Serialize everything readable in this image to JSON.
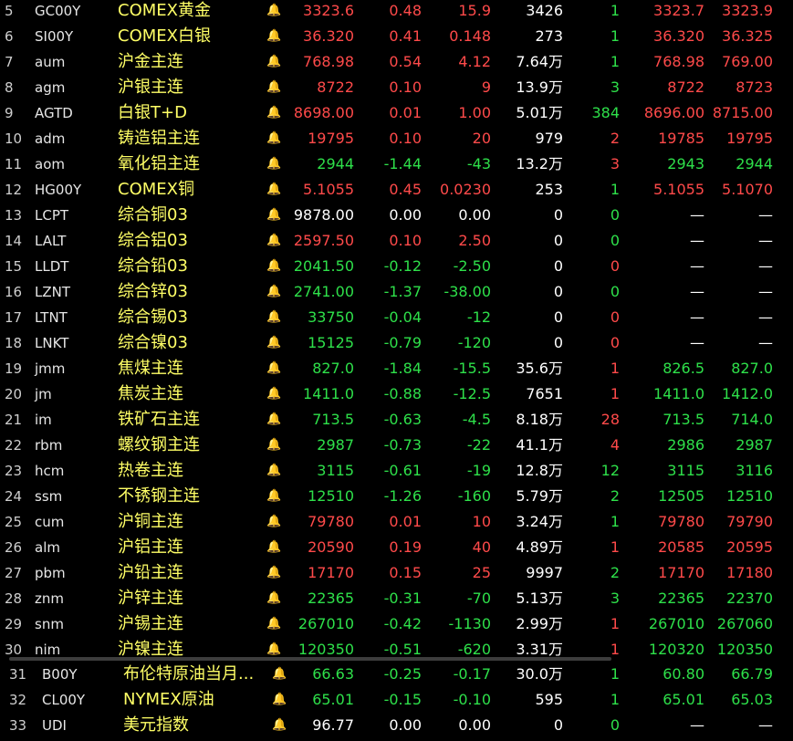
{
  "colors": {
    "up": "#ff4a4a",
    "down": "#2ee04a",
    "flat": "#ffffff",
    "name": "#ffff66",
    "background": "#000000"
  },
  "icons": {
    "row_alert": "bell-icon"
  },
  "bell_glyph": "🔔",
  "rows": [
    {
      "idx": "5",
      "code": "GC00Y",
      "name": "COMEX黄金",
      "price": "3323.6",
      "pct": "0.48",
      "chg": "15.9",
      "vol": "3426",
      "cur": "1",
      "bid": "3323.7",
      "ask": "3323.9",
      "pc": "red",
      "pctc": "red",
      "curc": "green",
      "bidc": "red",
      "askc": "red"
    },
    {
      "idx": "6",
      "code": "SI00Y",
      "name": "COMEX白银",
      "price": "36.320",
      "pct": "0.41",
      "chg": "0.148",
      "vol": "273",
      "cur": "1",
      "bid": "36.320",
      "ask": "36.325",
      "pc": "red",
      "pctc": "red",
      "curc": "green",
      "bidc": "red",
      "askc": "red"
    },
    {
      "idx": "7",
      "code": "aum",
      "name": "沪金主连",
      "price": "768.98",
      "pct": "0.54",
      "chg": "4.12",
      "vol": "7.64万",
      "cur": "1",
      "bid": "768.98",
      "ask": "769.00",
      "pc": "red",
      "pctc": "red",
      "curc": "green",
      "bidc": "red",
      "askc": "red"
    },
    {
      "idx": "8",
      "code": "agm",
      "name": "沪银主连",
      "price": "8722",
      "pct": "0.10",
      "chg": "9",
      "vol": "13.9万",
      "cur": "3",
      "bid": "8722",
      "ask": "8723",
      "pc": "red",
      "pctc": "red",
      "curc": "green",
      "bidc": "red",
      "askc": "red"
    },
    {
      "idx": "9",
      "code": "AGTD",
      "name": "白银T+D",
      "price": "8698.00",
      "pct": "0.01",
      "chg": "1.00",
      "vol": "5.01万",
      "cur": "384",
      "bid": "8696.00",
      "ask": "8715.00",
      "pc": "red",
      "pctc": "red",
      "curc": "green",
      "bidc": "red",
      "askc": "red"
    },
    {
      "idx": "10",
      "code": "adm",
      "name": "铸造铝主连",
      "price": "19795",
      "pct": "0.10",
      "chg": "20",
      "vol": "979",
      "cur": "2",
      "bid": "19785",
      "ask": "19795",
      "pc": "red",
      "pctc": "red",
      "curc": "red",
      "bidc": "red",
      "askc": "red"
    },
    {
      "idx": "11",
      "code": "aom",
      "name": "氧化铝主连",
      "price": "2944",
      "pct": "-1.44",
      "chg": "-43",
      "vol": "13.2万",
      "cur": "3",
      "bid": "2943",
      "ask": "2944",
      "pc": "green",
      "pctc": "green",
      "curc": "red",
      "bidc": "green",
      "askc": "green"
    },
    {
      "idx": "12",
      "code": "HG00Y",
      "name": "COMEX铜",
      "price": "5.1055",
      "pct": "0.45",
      "chg": "0.0230",
      "vol": "253",
      "cur": "1",
      "bid": "5.1055",
      "ask": "5.1070",
      "pc": "red",
      "pctc": "red",
      "curc": "green",
      "bidc": "red",
      "askc": "red"
    },
    {
      "idx": "13",
      "code": "LCPT",
      "name": "综合铜03",
      "price": "9878.00",
      "pct": "0.00",
      "chg": "0.00",
      "vol": "0",
      "cur": "0",
      "bid": "—",
      "ask": "—",
      "pc": "white",
      "pctc": "white",
      "curc": "green",
      "bidc": "white",
      "askc": "white"
    },
    {
      "idx": "14",
      "code": "LALT",
      "name": "综合铝03",
      "price": "2597.50",
      "pct": "0.10",
      "chg": "2.50",
      "vol": "0",
      "cur": "0",
      "bid": "—",
      "ask": "—",
      "pc": "red",
      "pctc": "red",
      "curc": "green",
      "bidc": "white",
      "askc": "white"
    },
    {
      "idx": "15",
      "code": "LLDT",
      "name": "综合铅03",
      "price": "2041.50",
      "pct": "-0.12",
      "chg": "-2.50",
      "vol": "0",
      "cur": "0",
      "bid": "—",
      "ask": "—",
      "pc": "green",
      "pctc": "green",
      "curc": "red",
      "bidc": "white",
      "askc": "white"
    },
    {
      "idx": "16",
      "code": "LZNT",
      "name": "综合锌03",
      "price": "2741.00",
      "pct": "-1.37",
      "chg": "-38.00",
      "vol": "0",
      "cur": "0",
      "bid": "—",
      "ask": "—",
      "pc": "green",
      "pctc": "green",
      "curc": "green",
      "bidc": "white",
      "askc": "white"
    },
    {
      "idx": "17",
      "code": "LTNT",
      "name": "综合锡03",
      "price": "33750",
      "pct": "-0.04",
      "chg": "-12",
      "vol": "0",
      "cur": "0",
      "bid": "—",
      "ask": "—",
      "pc": "green",
      "pctc": "green",
      "curc": "red",
      "bidc": "white",
      "askc": "white"
    },
    {
      "idx": "18",
      "code": "LNKT",
      "name": "综合镍03",
      "price": "15125",
      "pct": "-0.79",
      "chg": "-120",
      "vol": "0",
      "cur": "0",
      "bid": "—",
      "ask": "—",
      "pc": "green",
      "pctc": "green",
      "curc": "red",
      "bidc": "white",
      "askc": "white"
    },
    {
      "idx": "19",
      "code": "jmm",
      "name": "焦煤主连",
      "price": "827.0",
      "pct": "-1.84",
      "chg": "-15.5",
      "vol": "35.6万",
      "cur": "1",
      "bid": "826.5",
      "ask": "827.0",
      "pc": "green",
      "pctc": "green",
      "curc": "red",
      "bidc": "green",
      "askc": "green"
    },
    {
      "idx": "20",
      "code": "jm",
      "name": "焦炭主连",
      "price": "1411.0",
      "pct": "-0.88",
      "chg": "-12.5",
      "vol": "7651",
      "cur": "1",
      "bid": "1411.0",
      "ask": "1412.0",
      "pc": "green",
      "pctc": "green",
      "curc": "red",
      "bidc": "green",
      "askc": "green"
    },
    {
      "idx": "21",
      "code": "im",
      "name": "铁矿石主连",
      "price": "713.5",
      "pct": "-0.63",
      "chg": "-4.5",
      "vol": "8.18万",
      "cur": "28",
      "bid": "713.5",
      "ask": "714.0",
      "pc": "green",
      "pctc": "green",
      "curc": "red",
      "bidc": "green",
      "askc": "green"
    },
    {
      "idx": "22",
      "code": "rbm",
      "name": "螺纹钢主连",
      "price": "2987",
      "pct": "-0.73",
      "chg": "-22",
      "vol": "41.1万",
      "cur": "4",
      "bid": "2986",
      "ask": "2987",
      "pc": "green",
      "pctc": "green",
      "curc": "red",
      "bidc": "green",
      "askc": "green"
    },
    {
      "idx": "23",
      "code": "hcm",
      "name": "热卷主连",
      "price": "3115",
      "pct": "-0.61",
      "chg": "-19",
      "vol": "12.8万",
      "cur": "12",
      "bid": "3115",
      "ask": "3116",
      "pc": "green",
      "pctc": "green",
      "curc": "green",
      "bidc": "green",
      "askc": "green"
    },
    {
      "idx": "24",
      "code": "ssm",
      "name": "不锈钢主连",
      "price": "12510",
      "pct": "-1.26",
      "chg": "-160",
      "vol": "5.79万",
      "cur": "2",
      "bid": "12505",
      "ask": "12510",
      "pc": "green",
      "pctc": "green",
      "curc": "green",
      "bidc": "green",
      "askc": "green"
    },
    {
      "idx": "25",
      "code": "cum",
      "name": "沪铜主连",
      "price": "79780",
      "pct": "0.01",
      "chg": "10",
      "vol": "3.24万",
      "cur": "1",
      "bid": "79780",
      "ask": "79790",
      "pc": "red",
      "pctc": "red",
      "curc": "green",
      "bidc": "red",
      "askc": "red"
    },
    {
      "idx": "26",
      "code": "alm",
      "name": "沪铝主连",
      "price": "20590",
      "pct": "0.19",
      "chg": "40",
      "vol": "4.89万",
      "cur": "1",
      "bid": "20585",
      "ask": "20595",
      "pc": "red",
      "pctc": "red",
      "curc": "red",
      "bidc": "red",
      "askc": "red"
    },
    {
      "idx": "27",
      "code": "pbm",
      "name": "沪铅主连",
      "price": "17170",
      "pct": "0.15",
      "chg": "25",
      "vol": "9997",
      "cur": "2",
      "bid": "17170",
      "ask": "17180",
      "pc": "red",
      "pctc": "red",
      "curc": "green",
      "bidc": "red",
      "askc": "red"
    },
    {
      "idx": "28",
      "code": "znm",
      "name": "沪锌主连",
      "price": "22365",
      "pct": "-0.31",
      "chg": "-70",
      "vol": "5.13万",
      "cur": "3",
      "bid": "22365",
      "ask": "22370",
      "pc": "green",
      "pctc": "green",
      "curc": "green",
      "bidc": "green",
      "askc": "green"
    },
    {
      "idx": "29",
      "code": "snm",
      "name": "沪锡主连",
      "price": "267010",
      "pct": "-0.42",
      "chg": "-1130",
      "vol": "2.99万",
      "cur": "1",
      "bid": "267010",
      "ask": "267060",
      "pc": "green",
      "pctc": "green",
      "curc": "red",
      "bidc": "green",
      "askc": "green"
    },
    {
      "idx": "30",
      "code": "nim",
      "name": "沪镍主连",
      "price": "120350",
      "pct": "-0.51",
      "chg": "-620",
      "vol": "3.31万",
      "cur": "1",
      "bid": "120320",
      "ask": "120350",
      "pc": "green",
      "pctc": "green",
      "curc": "red",
      "bidc": "green",
      "askc": "green"
    }
  ],
  "rows2": [
    {
      "idx": "31",
      "code": "B00Y",
      "name": "布伦特原油当月...",
      "price": "66.63",
      "pct": "-0.25",
      "chg": "-0.17",
      "vol": "30.0万",
      "cur": "1",
      "bid": "60.80",
      "ask": "66.79",
      "pc": "green",
      "pctc": "green",
      "curc": "green",
      "bidc": "green",
      "askc": "green"
    },
    {
      "idx": "32",
      "code": "CL00Y",
      "name": "NYMEX原油",
      "price": "65.01",
      "pct": "-0.15",
      "chg": "-0.10",
      "vol": "595",
      "cur": "1",
      "bid": "65.01",
      "ask": "65.03",
      "pc": "green",
      "pctc": "green",
      "curc": "green",
      "bidc": "green",
      "askc": "green"
    },
    {
      "idx": "33",
      "code": "UDI",
      "name": "美元指数",
      "price": "96.77",
      "pct": "0.00",
      "chg": "0.00",
      "vol": "0",
      "cur": "0",
      "bid": "—",
      "ask": "—",
      "pc": "white",
      "pctc": "white",
      "curc": "green",
      "bidc": "white",
      "askc": "white"
    }
  ]
}
